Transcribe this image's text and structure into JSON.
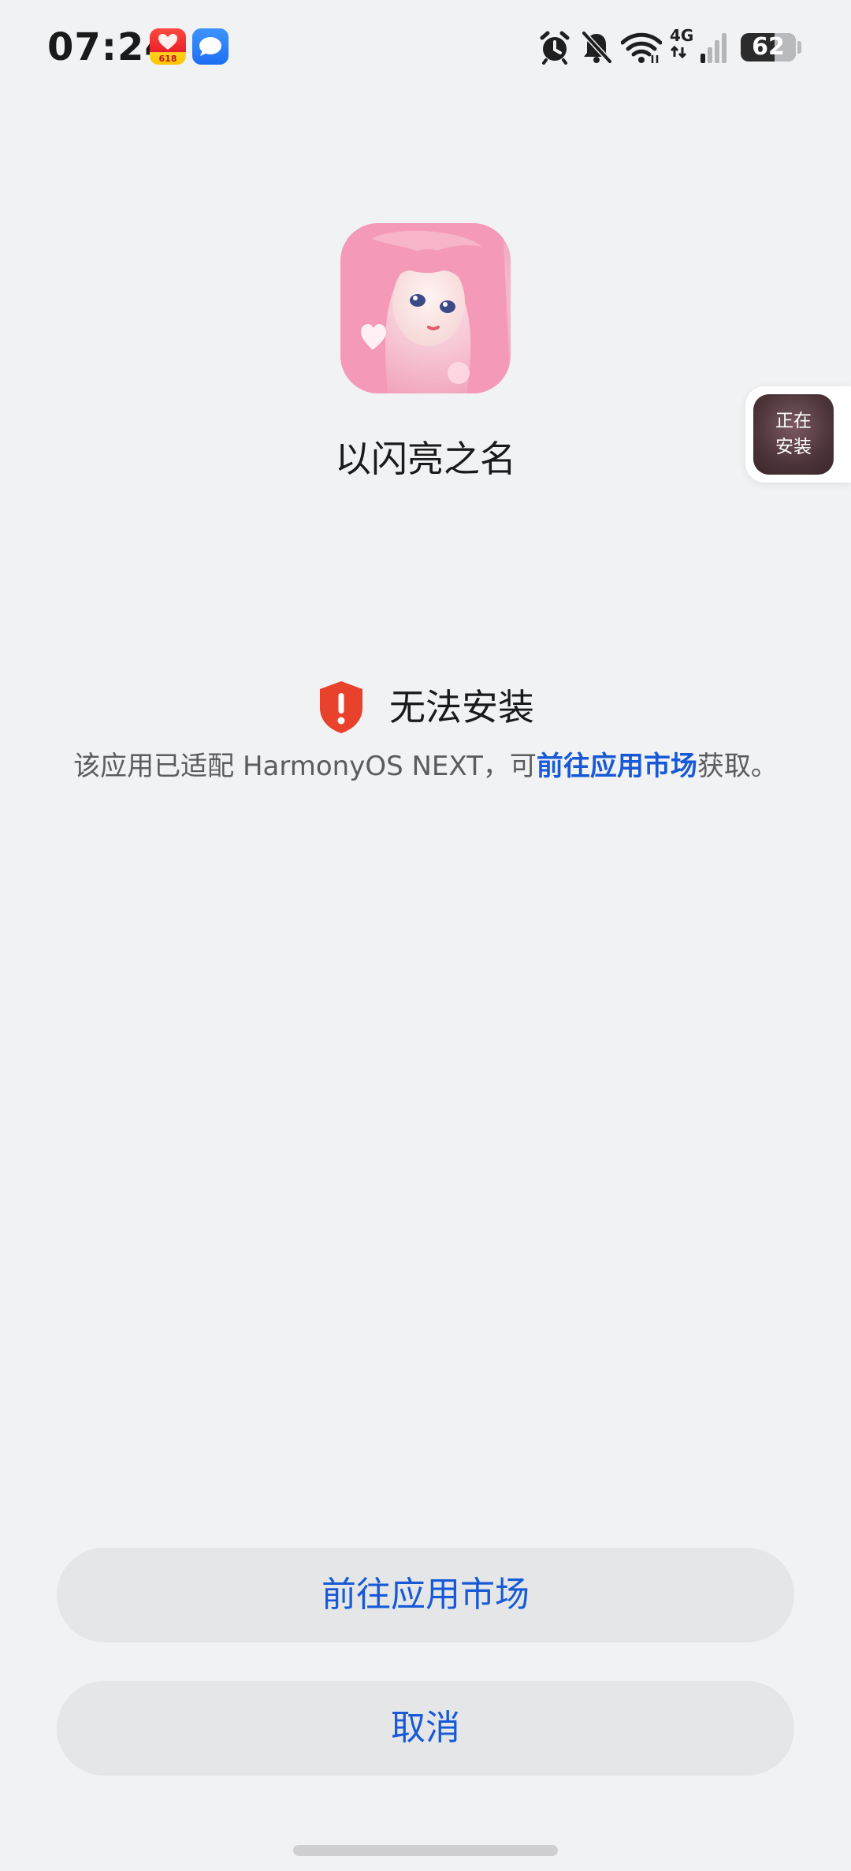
{
  "status_bar": {
    "time": "07:24",
    "shop_badge": "618",
    "network": "4G",
    "battery_level": 62,
    "battery_text": "62"
  },
  "app": {
    "name": "以闪亮之名"
  },
  "floating_install": {
    "label": "正在\n安装"
  },
  "install_status": {
    "title": "无法安装",
    "desc_before": "该应用已适配 HarmonyOS NEXT，可",
    "desc_link": "前往应用市场",
    "desc_after": "获取。"
  },
  "buttons": {
    "market": "前往应用市场",
    "cancel": "取消"
  },
  "colors": {
    "accent": "#1759d6",
    "warning": "#e8412c",
    "background": "#f1f2f4",
    "button_bg": "#e5e6e8"
  }
}
